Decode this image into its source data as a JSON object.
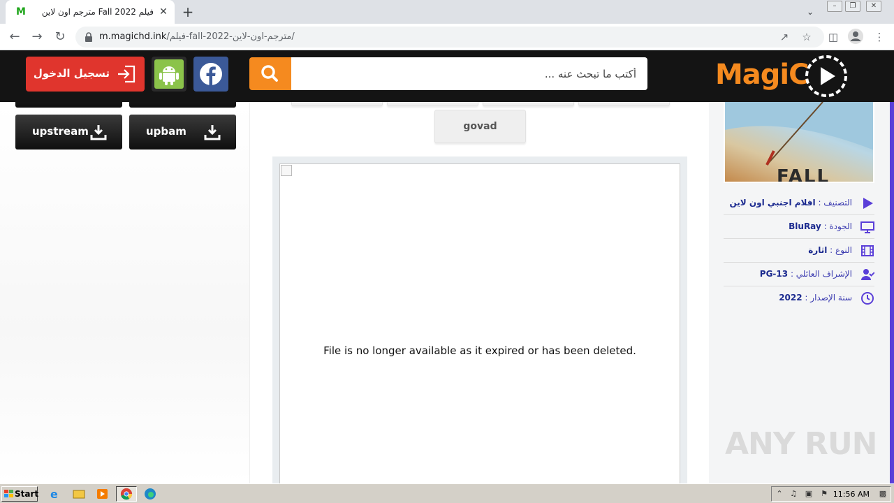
{
  "browser": {
    "tab_title": "فيلم Fall 2022 مترجم اون لاين",
    "tab_favicon": "M",
    "tab_close": "✕",
    "new_tab": "+",
    "url_host": "m.magichd.ink",
    "url_path": "/فيلم-fall-2022-مترجم-اون-لاين/"
  },
  "header": {
    "logo_text": "MagiC",
    "search_placeholder": "أكتب ما تبحث عنه ...",
    "login_label": "تسجيل الدخول",
    "icons": [
      "search-icon",
      "facebook-icon",
      "android-icon",
      "login-icon",
      "play-icon"
    ],
    "colors": {
      "brand_orange": "#f58a1f",
      "login_red": "#e0352d",
      "facebook_blue": "#3b5998",
      "android_green": "#8bc34a",
      "accent_purple": "#5a3fd8"
    }
  },
  "downloads": {
    "buttons": [
      {
        "label": "upbam"
      },
      {
        "label": "upstream"
      }
    ]
  },
  "servers": {
    "buttons": [
      {
        "label": "govad"
      }
    ]
  },
  "player": {
    "message": "File is no longer available as it expired or has been deleted."
  },
  "poster": {
    "title_fragment": "FALL"
  },
  "movie_info": {
    "rows": [
      {
        "label": "التصنيف :",
        "value": "افلام اجنبي اون لاين",
        "icon": "play-icon"
      },
      {
        "label": "الجودة :",
        "value": "BluRay",
        "icon": "monitor-icon"
      },
      {
        "label": "النوع :",
        "value": "اثارة",
        "icon": "film-icon"
      },
      {
        "label": "الإشراف العائلي :",
        "value": "PG-13",
        "icon": "user-check-icon"
      },
      {
        "label": "سنة الإصدار :",
        "value": "2022",
        "icon": "clock-icon"
      }
    ]
  },
  "watermark": "ANY RUN",
  "taskbar": {
    "start_label": "Start",
    "clock": "11:56 AM"
  }
}
